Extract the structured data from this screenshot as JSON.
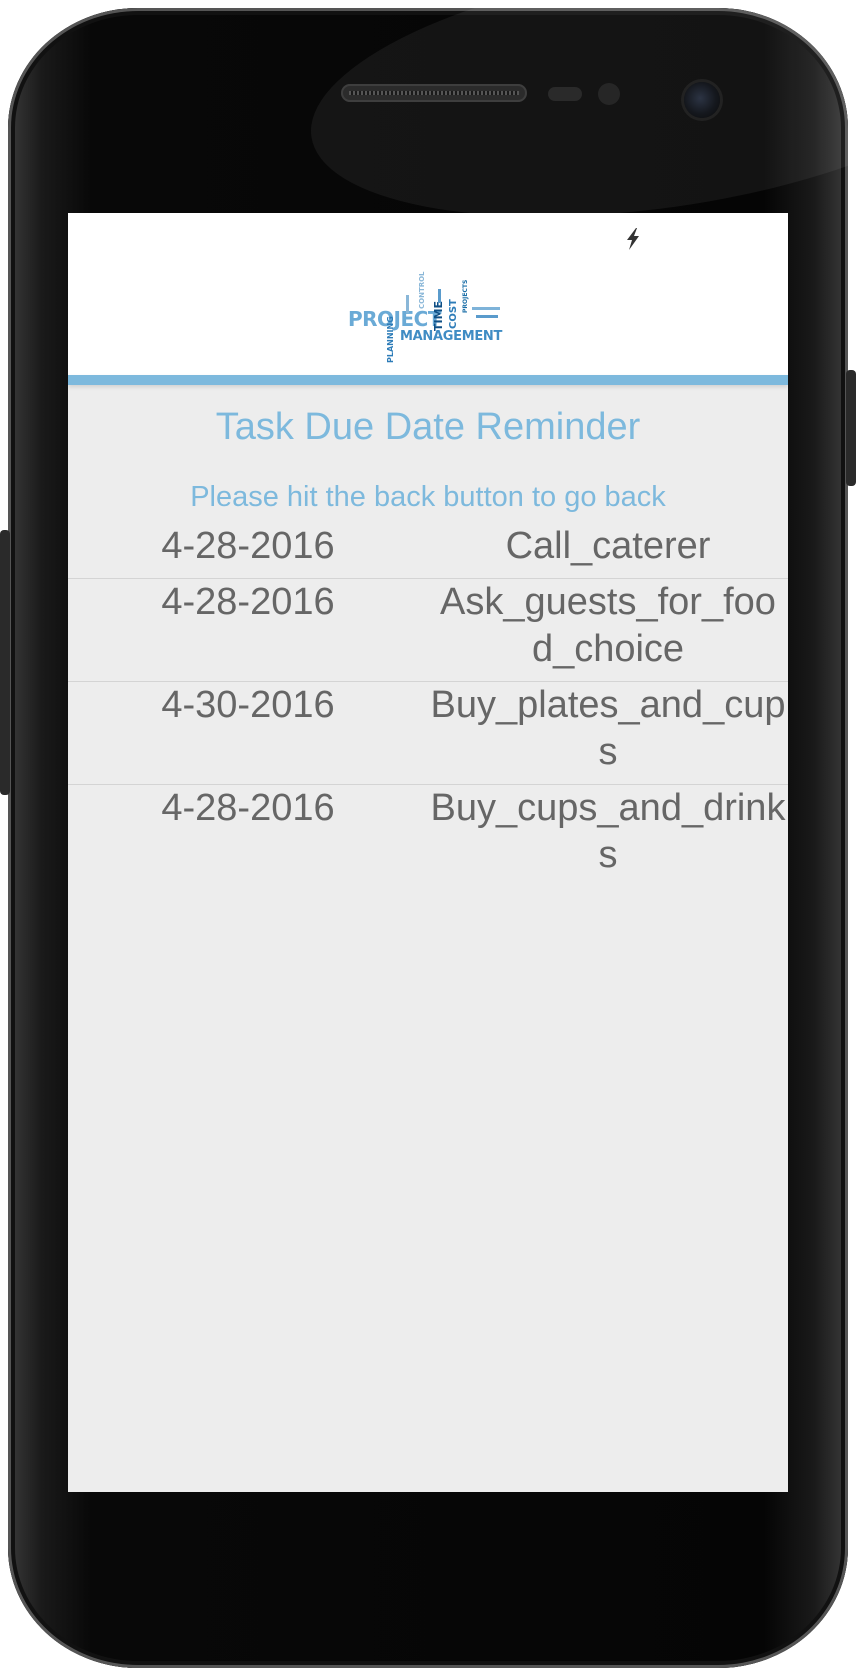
{
  "app": {
    "title": "Task Due Date Reminder",
    "back_hint": "Please hit the back button to go back",
    "logo_words": {
      "project": "PROJECT",
      "management": "MANAGEMENT",
      "time": "TIME",
      "cost": "COST",
      "control": "CONTROL",
      "planning": "PLANNING",
      "projects": "PROJECTS"
    }
  },
  "tasks": [
    {
      "date": "4-28-2016",
      "name": "Call_caterer"
    },
    {
      "date": "4-28-2016",
      "name": "Ask_guests_for_food_choice"
    },
    {
      "date": "4-30-2016",
      "name": "Buy_plates_and_cups"
    },
    {
      "date": "4-28-2016",
      "name": "Buy_cups_and_drinks"
    }
  ],
  "colors": {
    "accent": "#7db9dd",
    "text": "#666666",
    "background": "#ededed"
  },
  "icons": {
    "status": "flash-icon"
  }
}
